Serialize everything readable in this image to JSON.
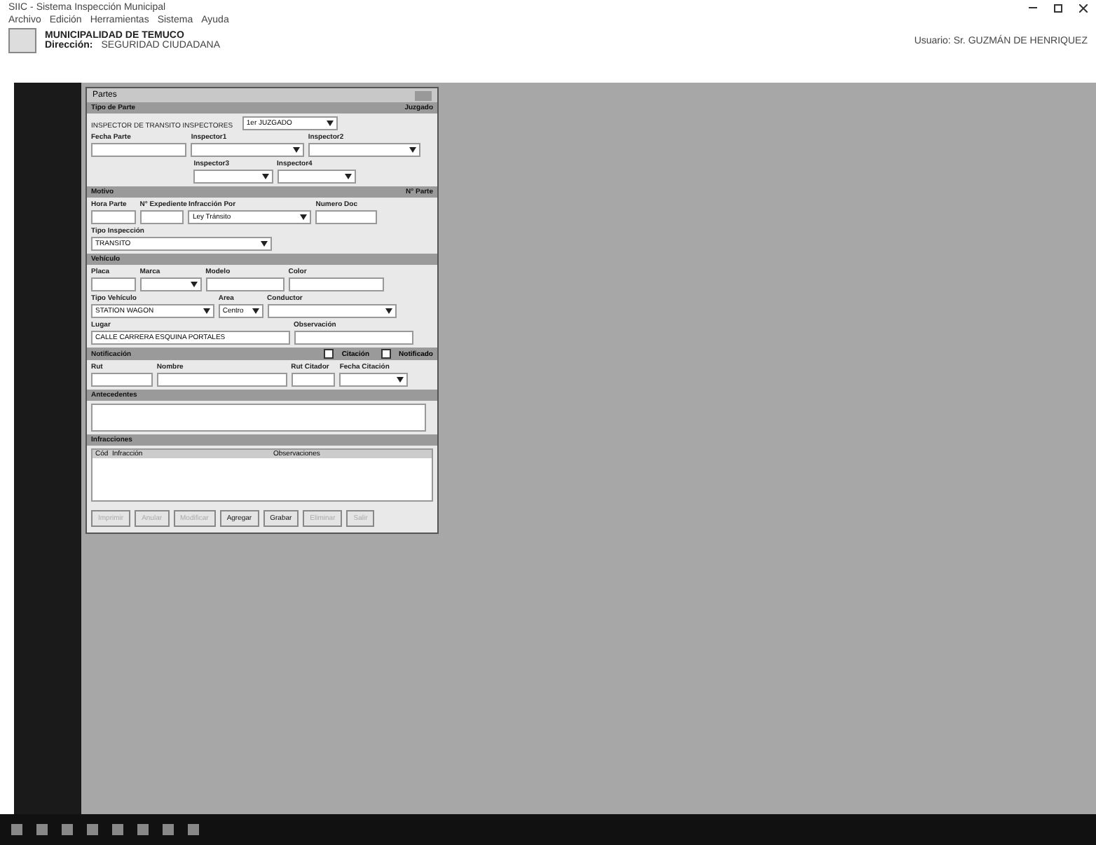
{
  "window": {
    "title": "SIIC - Sistema Inspección Municipal"
  },
  "menu": [
    "Archivo",
    "Edición",
    "Herramientas",
    "Sistema",
    "Ayuda"
  ],
  "header": {
    "org": "MUNICIPALIDAD DE TEMUCO",
    "unit_label": "Dirección:",
    "unit": "SEGURIDAD CIUDADANA",
    "user": "Usuario: Sr. GUZMÁN DE HENRIQUEZ"
  },
  "form": {
    "title": "Partes",
    "sections": [
      {
        "title": "Tipo de Parte",
        "aside": "Juzgado",
        "rows": [
          {
            "fields": [
              {
                "value": "INSPECTOR DE TRANSITO INSPECTORES",
                "kind": "static"
              },
              {
                "value": "1er JUZGADO",
                "kind": "select"
              }
            ]
          },
          {
            "fields": [
              {
                "label": "Fecha Parte",
                "kind": "text"
              },
              {
                "label": "Inspector1",
                "kind": "select"
              },
              {
                "label": "Inspector2",
                "kind": "select"
              }
            ]
          },
          {
            "fields": [
              {
                "label": "Inspector3",
                "kind": "select"
              },
              {
                "label": "Inspector4",
                "kind": "select"
              }
            ]
          }
        ]
      },
      {
        "title": "Motivo",
        "aside": "N° Parte",
        "rows": [
          {
            "fields": [
              {
                "label": "Hora Parte",
                "kind": "text"
              },
              {
                "label": "N° Expediente",
                "kind": "text"
              },
              {
                "label": "Infracción Por",
                "value": "Ley Tránsito",
                "kind": "select"
              },
              {
                "label": "Numero Doc",
                "kind": "text"
              }
            ]
          },
          {
            "fields": [
              {
                "label": "Tipo Inspección",
                "value": "TRANSITO",
                "kind": "select"
              }
            ]
          }
        ]
      },
      {
        "title": "Vehículo",
        "rows": [
          {
            "fields": [
              {
                "label": "Placa",
                "kind": "text"
              },
              {
                "label": "Marca",
                "kind": "select"
              },
              {
                "label": "Modelo",
                "kind": "text"
              },
              {
                "label": "Color",
                "kind": "text"
              }
            ]
          },
          {
            "fields": [
              {
                "label": "Tipo Vehículo",
                "value": "STATION WAGON",
                "kind": "select"
              },
              {
                "label": "Area",
                "value": "Centro",
                "kind": "select"
              },
              {
                "label": "Conductor",
                "kind": "select"
              }
            ]
          },
          {
            "fields": [
              {
                "label": "Lugar",
                "value": "CALLE CARRERA ESQUINA PORTALES",
                "kind": "text"
              },
              {
                "label": "Observación",
                "kind": "text"
              }
            ]
          }
        ]
      },
      {
        "title": "Notificación",
        "rows": [
          {
            "fields": [
              {
                "label": "Rut",
                "kind": "text"
              },
              {
                "label": "Nombre",
                "kind": "text"
              },
              {
                "label": "Rut Citador",
                "kind": "text"
              },
              {
                "label": "Fecha Citación",
                "kind": "select"
              }
            ]
          }
        ]
      },
      {
        "title": "Antecedentes",
        "rows": [
          {
            "fields": [
              {
                "kind": "area"
              }
            ]
          }
        ]
      }
    ],
    "checks": [
      {
        "label": "Citación",
        "checked": false
      },
      {
        "label": "Notificado",
        "checked": false
      }
    ],
    "infractions": {
      "title": "Infracciones",
      "columns": [
        "Cód",
        "Infracción",
        "Observaciones"
      ]
    },
    "buttons": [
      {
        "label": "Imprimir",
        "disabled": true
      },
      {
        "label": "Anular",
        "disabled": true
      },
      {
        "label": "Modificar",
        "disabled": true
      },
      {
        "label": "Agregar",
        "disabled": false
      },
      {
        "label": "Grabar",
        "disabled": false
      },
      {
        "label": "Eliminar",
        "disabled": true
      },
      {
        "label": "Salir",
        "disabled": true
      }
    ]
  }
}
